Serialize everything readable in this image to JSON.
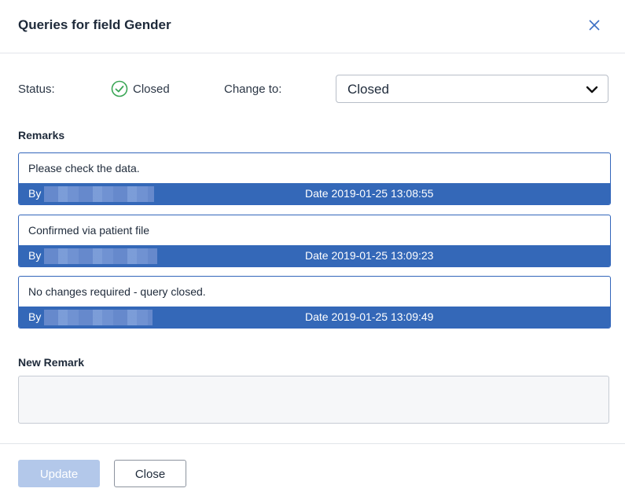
{
  "dialog": {
    "title": "Queries for field Gender",
    "close_icon": "close-icon"
  },
  "status": {
    "label": "Status:",
    "icon": "check-circle-icon",
    "icon_color": "#3aa655",
    "value": "Closed",
    "change_label": "Change to:",
    "select_value": "Closed"
  },
  "remarks": {
    "heading": "Remarks",
    "items": [
      {
        "text": "Please check the data.",
        "by_label": "By",
        "date": "Date 2019-01-25 13:08:55"
      },
      {
        "text": "Confirmed via patient file",
        "by_label": "By",
        "date": "Date 2019-01-25 13:09:23"
      },
      {
        "text": "No changes required - query closed.",
        "by_label": "By",
        "date": "Date 2019-01-25 13:09:49"
      }
    ]
  },
  "new_remark": {
    "heading": "New Remark",
    "value": "",
    "placeholder": ""
  },
  "footer": {
    "update_label": "Update",
    "close_label": "Close"
  },
  "colors": {
    "accent": "#3468b8",
    "update_disabled": "#b3c8ea"
  }
}
